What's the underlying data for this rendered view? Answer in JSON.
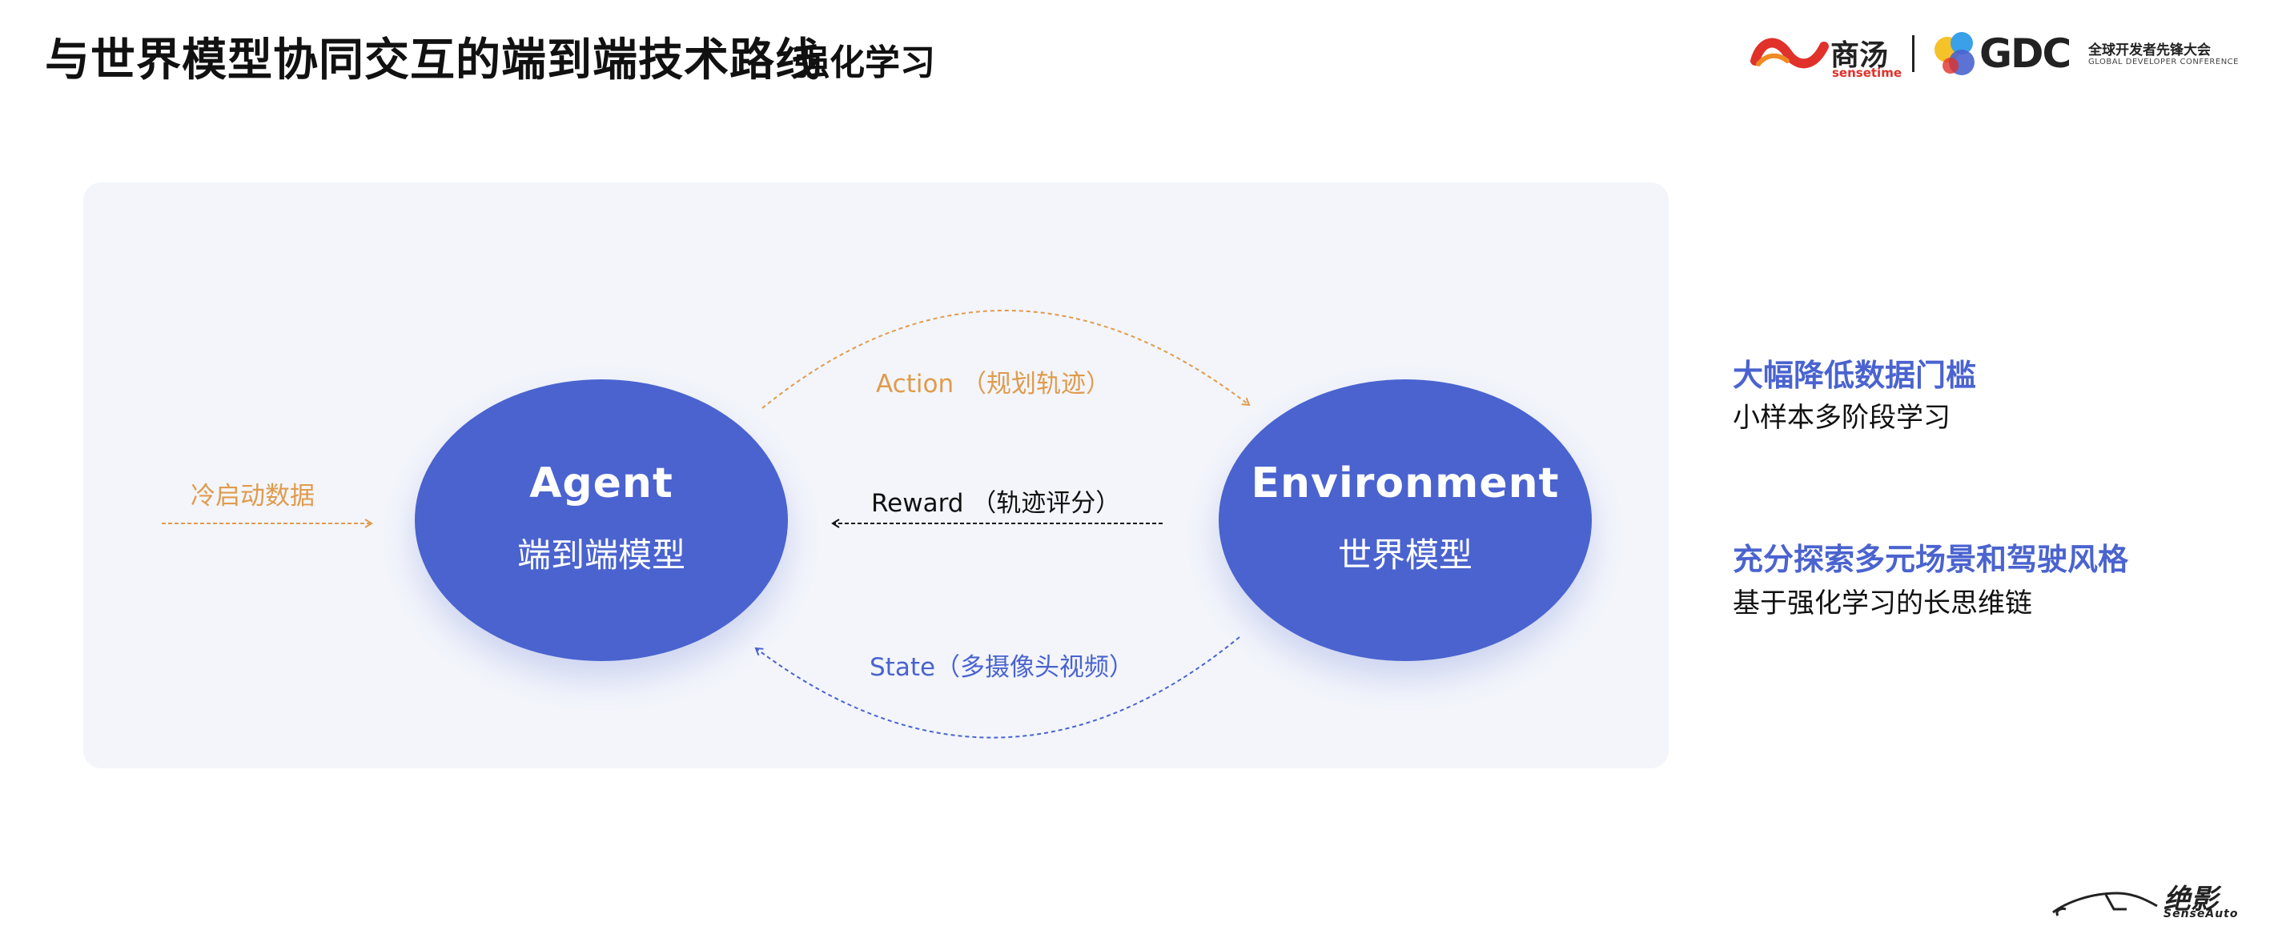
{
  "title": "与世界模型协同交互的端到端技术路线",
  "logos": {
    "sensetime_cn": "商汤",
    "sensetime_en": "sensetime",
    "godc_text": "GDC",
    "godc_cn": "全球开发者先锋大会",
    "godc_en": "GLOBAL DEVELOPER CONFERENCE",
    "footer_cn": "绝影",
    "footer_en": "SenseAuto"
  },
  "diagram": {
    "title": "强化学习",
    "agent": {
      "name": "Agent",
      "subtitle": "端到端模型"
    },
    "environment": {
      "name": "Environment",
      "subtitle": "世界模型"
    },
    "action_label": "Action （规划轨迹）",
    "reward_label": "Reward （轨迹评分）",
    "state_label": "State（多摄像头视频）",
    "cold_start_label": "冷启动数据"
  },
  "bullets": [
    {
      "heading": "大幅降低数据门槛",
      "sub": "小样本多阶段学习"
    },
    {
      "heading": "充分探索多元场景和驾驶风格",
      "sub": "基于强化学习的长思维链"
    }
  ],
  "colors": {
    "circle": "#4a63cf",
    "panel": "#f3f5fb",
    "orange": "#e09b4c",
    "blue_text": "#4a63cf"
  }
}
